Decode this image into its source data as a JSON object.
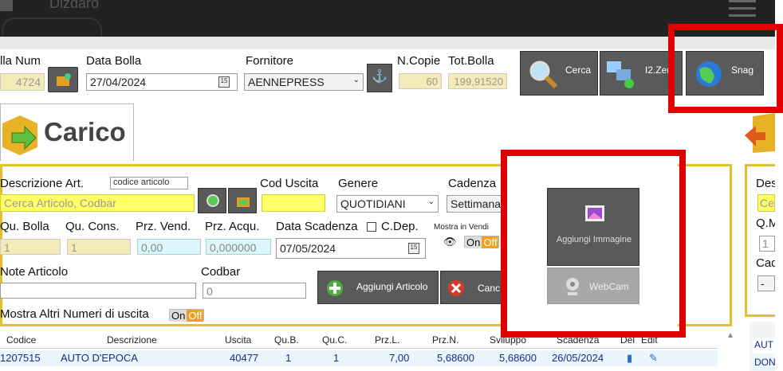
{
  "topbar": {
    "title": "Dizdaro"
  },
  "header": {
    "bolla_num_label": "lla Num",
    "bolla_num_value": "4724",
    "data_bolla_label": "Data Bolla",
    "data_bolla_value": "27/04/2024",
    "fornitore_label": "Fornitore",
    "fornitore_value": "AENNEPRESS",
    "ncopie_label": "N.Copie",
    "ncopie_value": "60",
    "totbolla_label": "Tot.Bolla",
    "totbolla_value": "199,91520"
  },
  "toolbar": {
    "cerca_label": "Cerca",
    "i2zen_label": "I2.Zen",
    "snag_label": "Snag"
  },
  "section": {
    "title": "Carico"
  },
  "form": {
    "descrizione_label": "Descrizione Art.",
    "codice_articolo_placeholder": "codice articolo",
    "search_placeholder": "Cerca Articolo, Codbar",
    "cod_uscita_label": "Cod Uscita",
    "genere_label": "Genere",
    "genere_value": "QUOTIDIANI",
    "cadenza_label": "Cadenza",
    "cadenza_value": "Settimanale",
    "qu_bolla_label": "Qu. Bolla",
    "qu_bolla_value": "1",
    "qu_cons_label": "Qu. Cons.",
    "qu_cons_value": "1",
    "prz_vend_label": "Prz. Vend.",
    "prz_vend_value": "0,00",
    "prz_acqu_label": "Prz. Acqu.",
    "prz_acqu_value": "0,000000",
    "data_scadenza_label": "Data Scadenza",
    "data_scadenza_value": "07/05/2024",
    "cdep_label": "C.Dep.",
    "mostra_vendita_label": "Mostra in Vendi",
    "toggle_on": "On",
    "toggle_off": "Off",
    "note_label": "Note Articolo",
    "codbar_label": "Codbar",
    "codbar_value": "0",
    "aggiungi_articolo_label": "Aggiungi Articolo",
    "cancel_label": "Canc",
    "mostra_altri_label": "Mostra Altri Numeri di uscita",
    "aggiungi_immagine_label": "Aggiungi Immagine",
    "webcam_label": "WebCam"
  },
  "table": {
    "headers": [
      "Codice",
      "Descrizione",
      "Uscita",
      "Qu.B.",
      "Qu.C.",
      "Prz.L.",
      "Prz.N.",
      "Sviluppo",
      "Scadenza",
      "Del",
      "Edit"
    ],
    "rows": [
      [
        "1207515",
        "AUTO D'EPOCA",
        "40477",
        "1",
        "1",
        "7,00",
        "5,68600",
        "5,68600",
        "26/05/2024"
      ]
    ]
  },
  "right_panel": {
    "labels": [
      "Des",
      "Ce",
      "Q.M",
      "1",
      "Cad",
      "-"
    ],
    "list": [
      "AUT",
      "DON"
    ]
  },
  "colors": {
    "highlight_red": "#e00000",
    "panel_border": "#e3c12a",
    "toggle_off": "#f0a020",
    "input_yellow": "#ffff66"
  }
}
